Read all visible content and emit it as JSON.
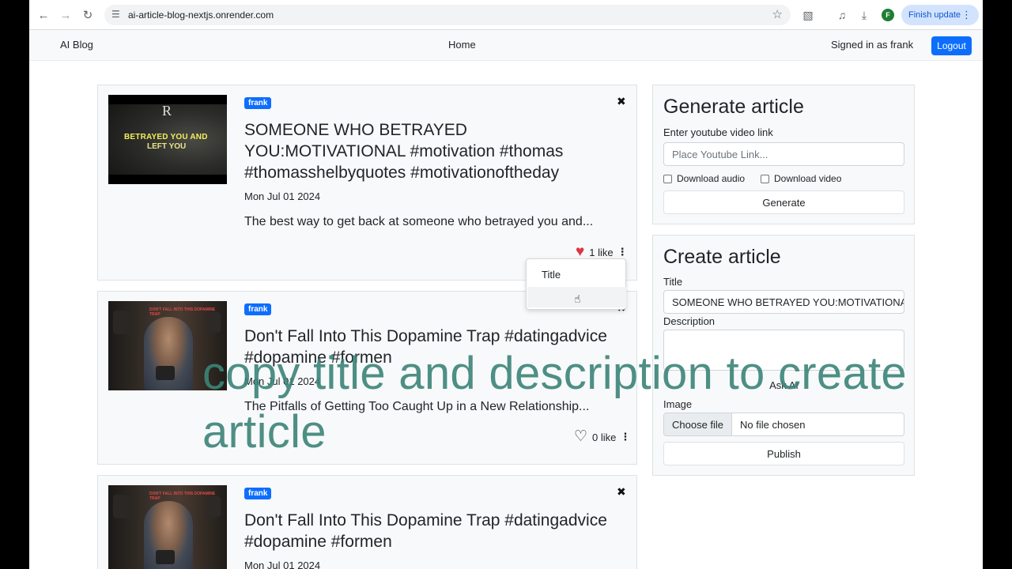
{
  "browser": {
    "url": "ai-article-blog-nextjs.onrender.com",
    "profile_initial": "F",
    "update_label": "Finish update"
  },
  "navbar": {
    "brand": "AI Blog",
    "home": "Home",
    "signed_in": "Signed in as frank",
    "logout": "Logout"
  },
  "articles": [
    {
      "author": "frank",
      "title": "SOMEONE WHO BETRAYED YOU:MOTIVATIONAL #motivation #thomas #thomasshelbyquotes #motivationoftheday",
      "date": "Mon Jul 01 2024",
      "description": "The best way to get back at someone who betrayed you and...",
      "likes": "1 like",
      "liked": true,
      "thumb_line1": "BETRAYED YOU AND",
      "thumb_line2": "LEFT YOU",
      "thumb_logo": "R"
    },
    {
      "author": "frank",
      "title": "Don't Fall Into This Dopamine Trap #datingadvice #dopamine #formen",
      "date": "Mon Jul 01 2024",
      "description": "The Pitfalls of Getting Too Caught Up in a New Relationship...",
      "likes": "0 like",
      "liked": false,
      "thumb_caption": "DON'T FALL INTO THIS DOPAMINE TRAP"
    },
    {
      "author": "frank",
      "title": "Don't Fall Into This Dopamine Trap #datingadvice #dopamine #formen",
      "date": "Mon Jul 01 2024",
      "thumb_caption": "DON'T FALL INTO THIS DOPAMINE TRAP"
    }
  ],
  "menu": {
    "item1": "Title"
  },
  "generate": {
    "heading": "Generate article",
    "label": "Enter youtube video link",
    "placeholder": "Place Youtube Link...",
    "download_audio": "Download audio",
    "download_video": "Download video",
    "button": "Generate"
  },
  "create": {
    "heading": "Create article",
    "title_label": "Title",
    "title_value": "SOMEONE WHO BETRAYED YOU:MOTIVATIONAL #motivation",
    "description_label": "Description",
    "ask_ai": "Ask AI",
    "image_label": "Image",
    "choose_file": "Choose file",
    "no_file": "No file chosen",
    "publish": "Publish"
  },
  "caption": "copy title and description to create article",
  "colors": {
    "primary": "#0d6efd",
    "heart": "#dc3545",
    "caption": "#3b8478"
  }
}
